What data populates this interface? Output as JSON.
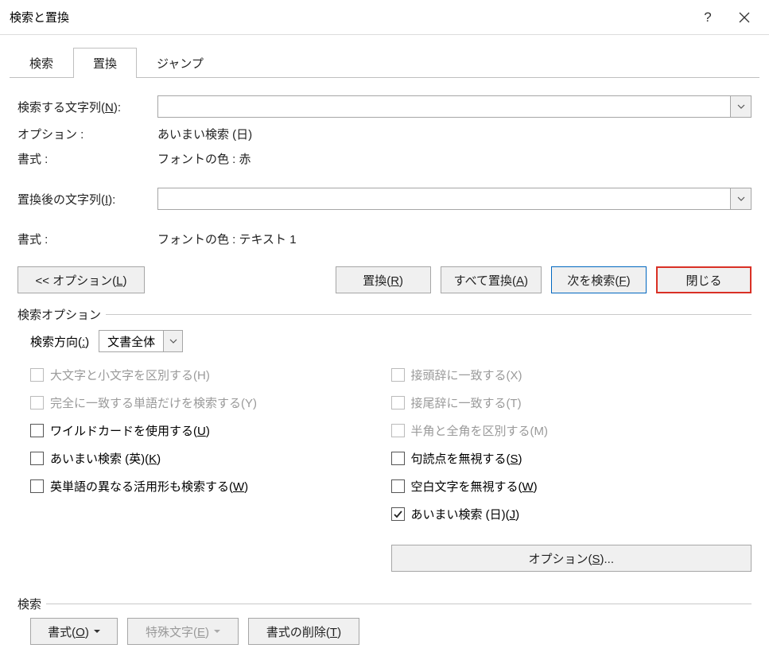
{
  "titlebar": {
    "title": "検索と置換",
    "help_label": "?",
    "close_label": "✕"
  },
  "tabs": {
    "find": "検索",
    "replace": "置換",
    "goto": "ジャンプ"
  },
  "form": {
    "find_label": "検索する文字列(N):",
    "find_value": "",
    "options_label": "オプション :",
    "options_value": "あいまい検索 (日)",
    "format_label": "書式 :",
    "format_find_value": "フォントの色 : 赤",
    "replace_label": "置換後の文字列(I):",
    "replace_value": "",
    "format_replace_value": "フォントの色 : テキスト 1"
  },
  "buttons": {
    "options_toggle": "<< オプション(L)",
    "replace": "置換(R)",
    "replace_all": "すべて置換(A)",
    "find_next": "次を検索(F)",
    "close": "閉じる"
  },
  "search_options": {
    "legend": "検索オプション",
    "direction_label": "検索方向(:)",
    "direction_value": "文書全体",
    "left": {
      "case": "大文字と小文字を区別する(H)",
      "whole_word": "完全に一致する単語だけを検索する(Y)",
      "wildcard": "ワイルドカードを使用する(U)",
      "fuzzy_en": "あいまい検索 (英)(K)",
      "word_forms": "英単語の異なる活用形も検索する(W)"
    },
    "right": {
      "prefix": "接頭辞に一致する(X)",
      "suffix": "接尾辞に一致する(T)",
      "half_full": "半角と全角を区別する(M)",
      "punctuation": "句読点を無視する(S)",
      "whitespace": "空白文字を無視する(W)",
      "fuzzy_jp": "あいまい検索 (日)(J)",
      "options_btn": "オプション(S)..."
    }
  },
  "search_footer": {
    "legend": "検索",
    "format": "書式(O)",
    "special": "特殊文字(E)",
    "clear_format": "書式の削除(T)"
  }
}
